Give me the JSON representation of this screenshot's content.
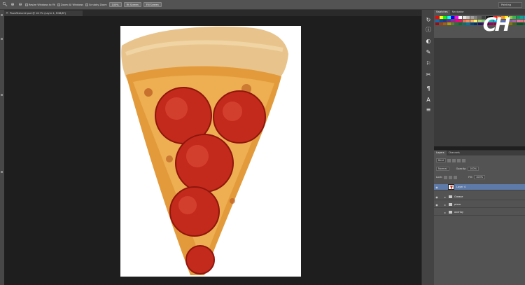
{
  "options_bar": {
    "resize_windows": "Resize Windows to Fit",
    "zoom_all_windows": "Zoom All Windows",
    "scrubby_zoom": "Scrubby Zoom",
    "btn_100": "100%",
    "btn_fit": "Fit Screen",
    "btn_fill": "Fill Screen",
    "workspace": "Painting"
  },
  "document_tab": {
    "title": "PizzaTexture2.psd @ 16.7% (Layer 4, RGB/8*)"
  },
  "swatches_panel": {
    "tabs": [
      "Swatches",
      "Navigator"
    ],
    "colors": [
      "#ff0000",
      "#ffff00",
      "#00ff00",
      "#00ffff",
      "#0000ff",
      "#ff00ff",
      "#ffffff",
      "#e0e0e0",
      "#c0c0c0",
      "#a0a0a0",
      "#808080",
      "#606060",
      "#404040",
      "#202020",
      "#000000",
      "#ed1c24",
      "#f26522",
      "#f7941d",
      "#fff200",
      "#8dc63f",
      "#39b54a",
      "#00a651",
      "#00a99d",
      "#00aeef",
      "#0072bc",
      "#0054a6",
      "#2e3192",
      "#662d91",
      "#92278f",
      "#ec008c",
      "#ed145b",
      "#f26c4f",
      "#f68e56",
      "#fbaf5d",
      "#fff568",
      "#acd373",
      "#7cc576",
      "#3cb878",
      "#1cbbb4",
      "#00bff3",
      "#448ccb",
      "#5674b9",
      "#605ca8",
      "#8560a8",
      "#a864a8",
      "#f06eaa",
      "#f26d7d",
      "#f7977a",
      "#9e0b0f",
      "#a0410d",
      "#a36209",
      "#aba000",
      "#598527",
      "#197b30",
      "#007236",
      "#00746b",
      "#0076a3",
      "#004a80",
      "#003471",
      "#1b1464",
      "#440e62",
      "#630460",
      "#9e005d",
      "#9e0039",
      "#790000",
      "#7b2e00",
      "#7d4900",
      "#827b00",
      "#406618",
      "#005e20",
      "#005826",
      "#005952"
    ],
    "logo_text": "CH"
  },
  "layers_panel": {
    "tabs": [
      "Layers",
      "Channels"
    ],
    "filter_kind": "Kind",
    "blend_mode": "Normal",
    "opacity_label": "Opacity:",
    "opacity_value": "100%",
    "lock_label": "Lock:",
    "fill_label": "Fill:",
    "fill_value": "100%",
    "layers": [
      {
        "name": "Layer 4",
        "type": "layer",
        "selected": true
      },
      {
        "name": "Grease",
        "type": "group"
      },
      {
        "name": "pizza",
        "type": "group"
      },
      {
        "name": "overlay",
        "type": "group"
      }
    ]
  }
}
